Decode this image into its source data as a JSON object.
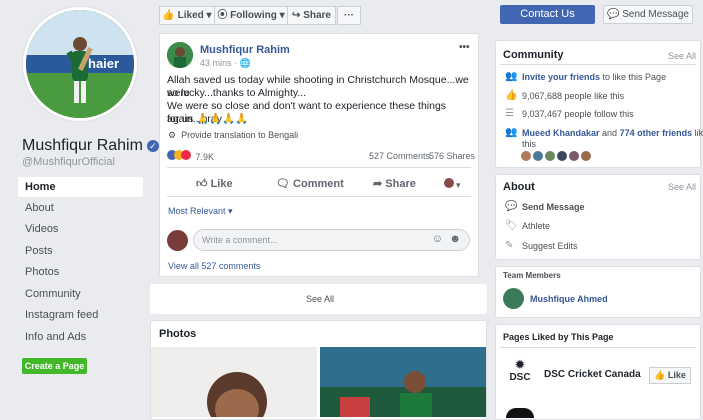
{
  "profile": {
    "name": "Mushfiqur Rahim",
    "handle": "@MushfiqurOfficial",
    "banner_text": "haier"
  },
  "nav": [
    "Home",
    "About",
    "Videos",
    "Posts",
    "Photos",
    "Community",
    "Instagram feed",
    "Info and Ads"
  ],
  "create_page": "Create a Page",
  "toolbar": {
    "liked": "Liked",
    "following": "Following",
    "share": "Share",
    "more": "···",
    "contact": "Contact Us",
    "send_message": "Send Message"
  },
  "post": {
    "author": "Mushfiqur Rahim",
    "time": "43 mins",
    "more": "•••",
    "line1": "Allah saved us today while shooting in Christchurch Mosque...we were",
    "line2": "so lucky...thanks to Almighty...",
    "line3": "We were so close and don't want to experience these things again...pray",
    "line4": "for us 🙏🙏🙏🙏",
    "translate": "Provide translation to Bengali",
    "reactions": "7.9K",
    "comments": "527 Comments",
    "shares": "576 Shares",
    "like": "Like",
    "comment": "Comment",
    "share": "Share",
    "sort": "Most Relevant",
    "comment_placeholder": "Write a comment...",
    "view_all": "View all 527 comments"
  },
  "see_all_center": "See All",
  "photos": {
    "title": "Photos"
  },
  "community": {
    "title": "Community",
    "see_all": "See All",
    "invite": "Invite your friends",
    "invite_rest": " to like this Page",
    "likes": "9,067,688 people like this",
    "follows": "9,037,467 people follow this",
    "friend": "Mueed Khandakar",
    "friend_mid": " and ",
    "friends_count": "774 other friends",
    "friend_rest": " like",
    "friend_end": "this"
  },
  "about": {
    "title": "About",
    "see_all": "See All",
    "send_message": "Send Message",
    "category": "Athlete",
    "suggest": "Suggest Edits"
  },
  "team": {
    "title": "Team Members",
    "member": "Mushfique Ahmed"
  },
  "pages_liked": {
    "title": "Pages Liked by This Page",
    "page": "DSC Cricket Canada",
    "logo": "DSC",
    "like": "Like"
  }
}
